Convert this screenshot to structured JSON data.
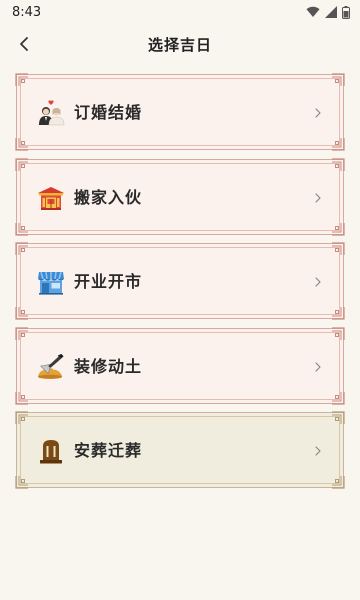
{
  "status_bar": {
    "time": "8:43"
  },
  "header": {
    "title": "选择吉日",
    "back_icon": "chevron-left-icon"
  },
  "categories": [
    {
      "label": "订婚结婚",
      "icon": "couple-icon"
    },
    {
      "label": "搬家入伙",
      "icon": "house-icon"
    },
    {
      "label": "开业开市",
      "icon": "storefront-icon"
    },
    {
      "label": "装修动土",
      "icon": "trowel-icon"
    },
    {
      "label": "安葬迁葬",
      "icon": "tombstone-icon"
    }
  ],
  "colors": {
    "background": "#f8f6ee",
    "card_red_bg": "#fbf2ee",
    "card_red_border": "#d9a9a1",
    "card_brown_bg": "#f0eddf",
    "card_brown_border": "#c9b49a"
  }
}
